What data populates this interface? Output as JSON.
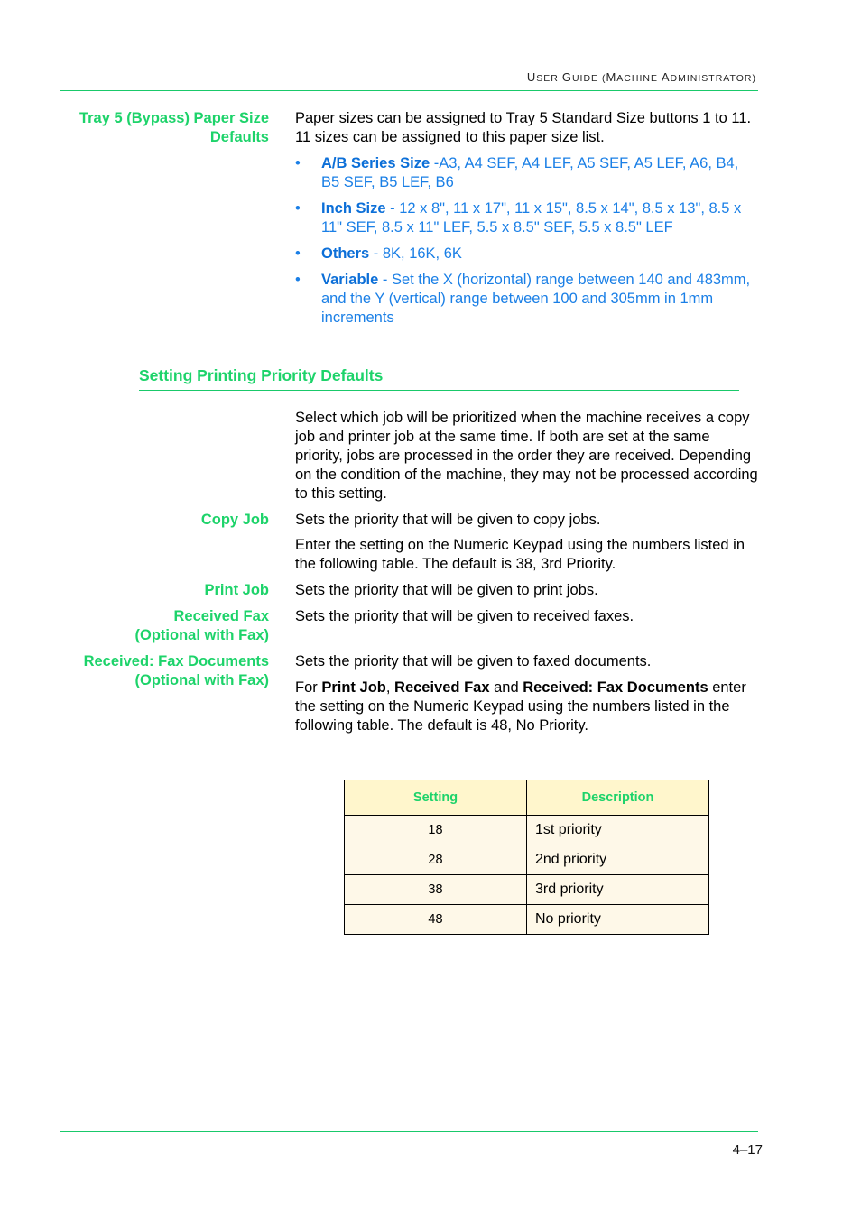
{
  "header": {
    "running_title_parts": [
      {
        "cap": "U",
        "rest": "SER "
      },
      {
        "cap": "G",
        "rest": "UIDE ("
      },
      {
        "cap": "M",
        "rest": "ACHINE "
      },
      {
        "cap": "A",
        "rest": "DMINISTRATOR)"
      }
    ]
  },
  "tray5": {
    "label_line1": "Tray 5 (Bypass) Paper Size",
    "label_line2": "Defaults",
    "intro": "Paper sizes can be assigned to Tray 5 Standard Size buttons 1 to 11. 11 sizes can be assigned to this paper size list.",
    "bullet_glyph": "•",
    "bullets": [
      {
        "term": "A/B Series Size",
        "text": " -A3, A4 SEF, A4 LEF, A5 SEF, A5 LEF, A6, B4, B5 SEF, B5 LEF, B6"
      },
      {
        "term": "Inch Size",
        "text": " - 12 x 8\", 11 x 17\", 11 x 15\", 8.5 x 14\", 8.5 x 13\", 8.5 x 11\" SEF, 8.5 x 11\" LEF, 5.5 x 8.5\" SEF, 5.5 x 8.5\" LEF"
      },
      {
        "term": "Others",
        "text": " - 8K, 16K, 6K"
      },
      {
        "term": "Variable",
        "text": " - Set the X (horizontal) range between 140 and 483mm, and the Y (vertical) range between 100 and 305mm in 1mm increments"
      }
    ]
  },
  "section": {
    "title": "Setting Printing Priority Defaults",
    "intro": "Select which job will be prioritized when the machine receives a copy job and printer job at the same time. If both are set at the same priority, jobs are processed in the order they are received. Depending on the condition of the machine, they may not be processed according to this setting."
  },
  "items": {
    "copy_job": {
      "label": "Copy Job",
      "text1": "Sets the priority that will be given to copy jobs.",
      "text2": "Enter the setting on the Numeric Keypad using the numbers listed in the following table. The default is 38, 3rd Priority."
    },
    "print_job": {
      "label": "Print Job",
      "text": "Sets the priority that will be given to print jobs."
    },
    "received_fax": {
      "label_line1": "Received Fax",
      "label_line2": "(Optional with Fax)",
      "text": "Sets the priority that will be given to received faxes."
    },
    "received_fax_docs": {
      "label_line1": "Received: Fax Documents",
      "label_line2": "(Optional with Fax)",
      "text1": "Sets the priority that will be given to faxed documents.",
      "text2_prefix": "For ",
      "text2_b1": "Print Job",
      "text2_sep1": ", ",
      "text2_b2": "Received Fax",
      "text2_sep2": " and ",
      "text2_b3": "Received: Fax Documents",
      "text2_rest": " enter the setting on the Numeric Keypad using the numbers listed in the following table. The default is 48, No Priority."
    }
  },
  "table": {
    "headers": [
      "Setting",
      "Description"
    ],
    "rows": [
      {
        "setting": "18",
        "description": "1st priority"
      },
      {
        "setting": "28",
        "description": "2nd priority"
      },
      {
        "setting": "38",
        "description": "3rd priority"
      },
      {
        "setting": "48",
        "description": "No priority"
      }
    ]
  },
  "footer": {
    "page_number": "4–17"
  },
  "colors": {
    "accent_green": "#1dd36a",
    "link_blue": "#1a7fe6",
    "table_header_bg": "#fff6cc",
    "table_cell_bg": "#fef8e8"
  }
}
